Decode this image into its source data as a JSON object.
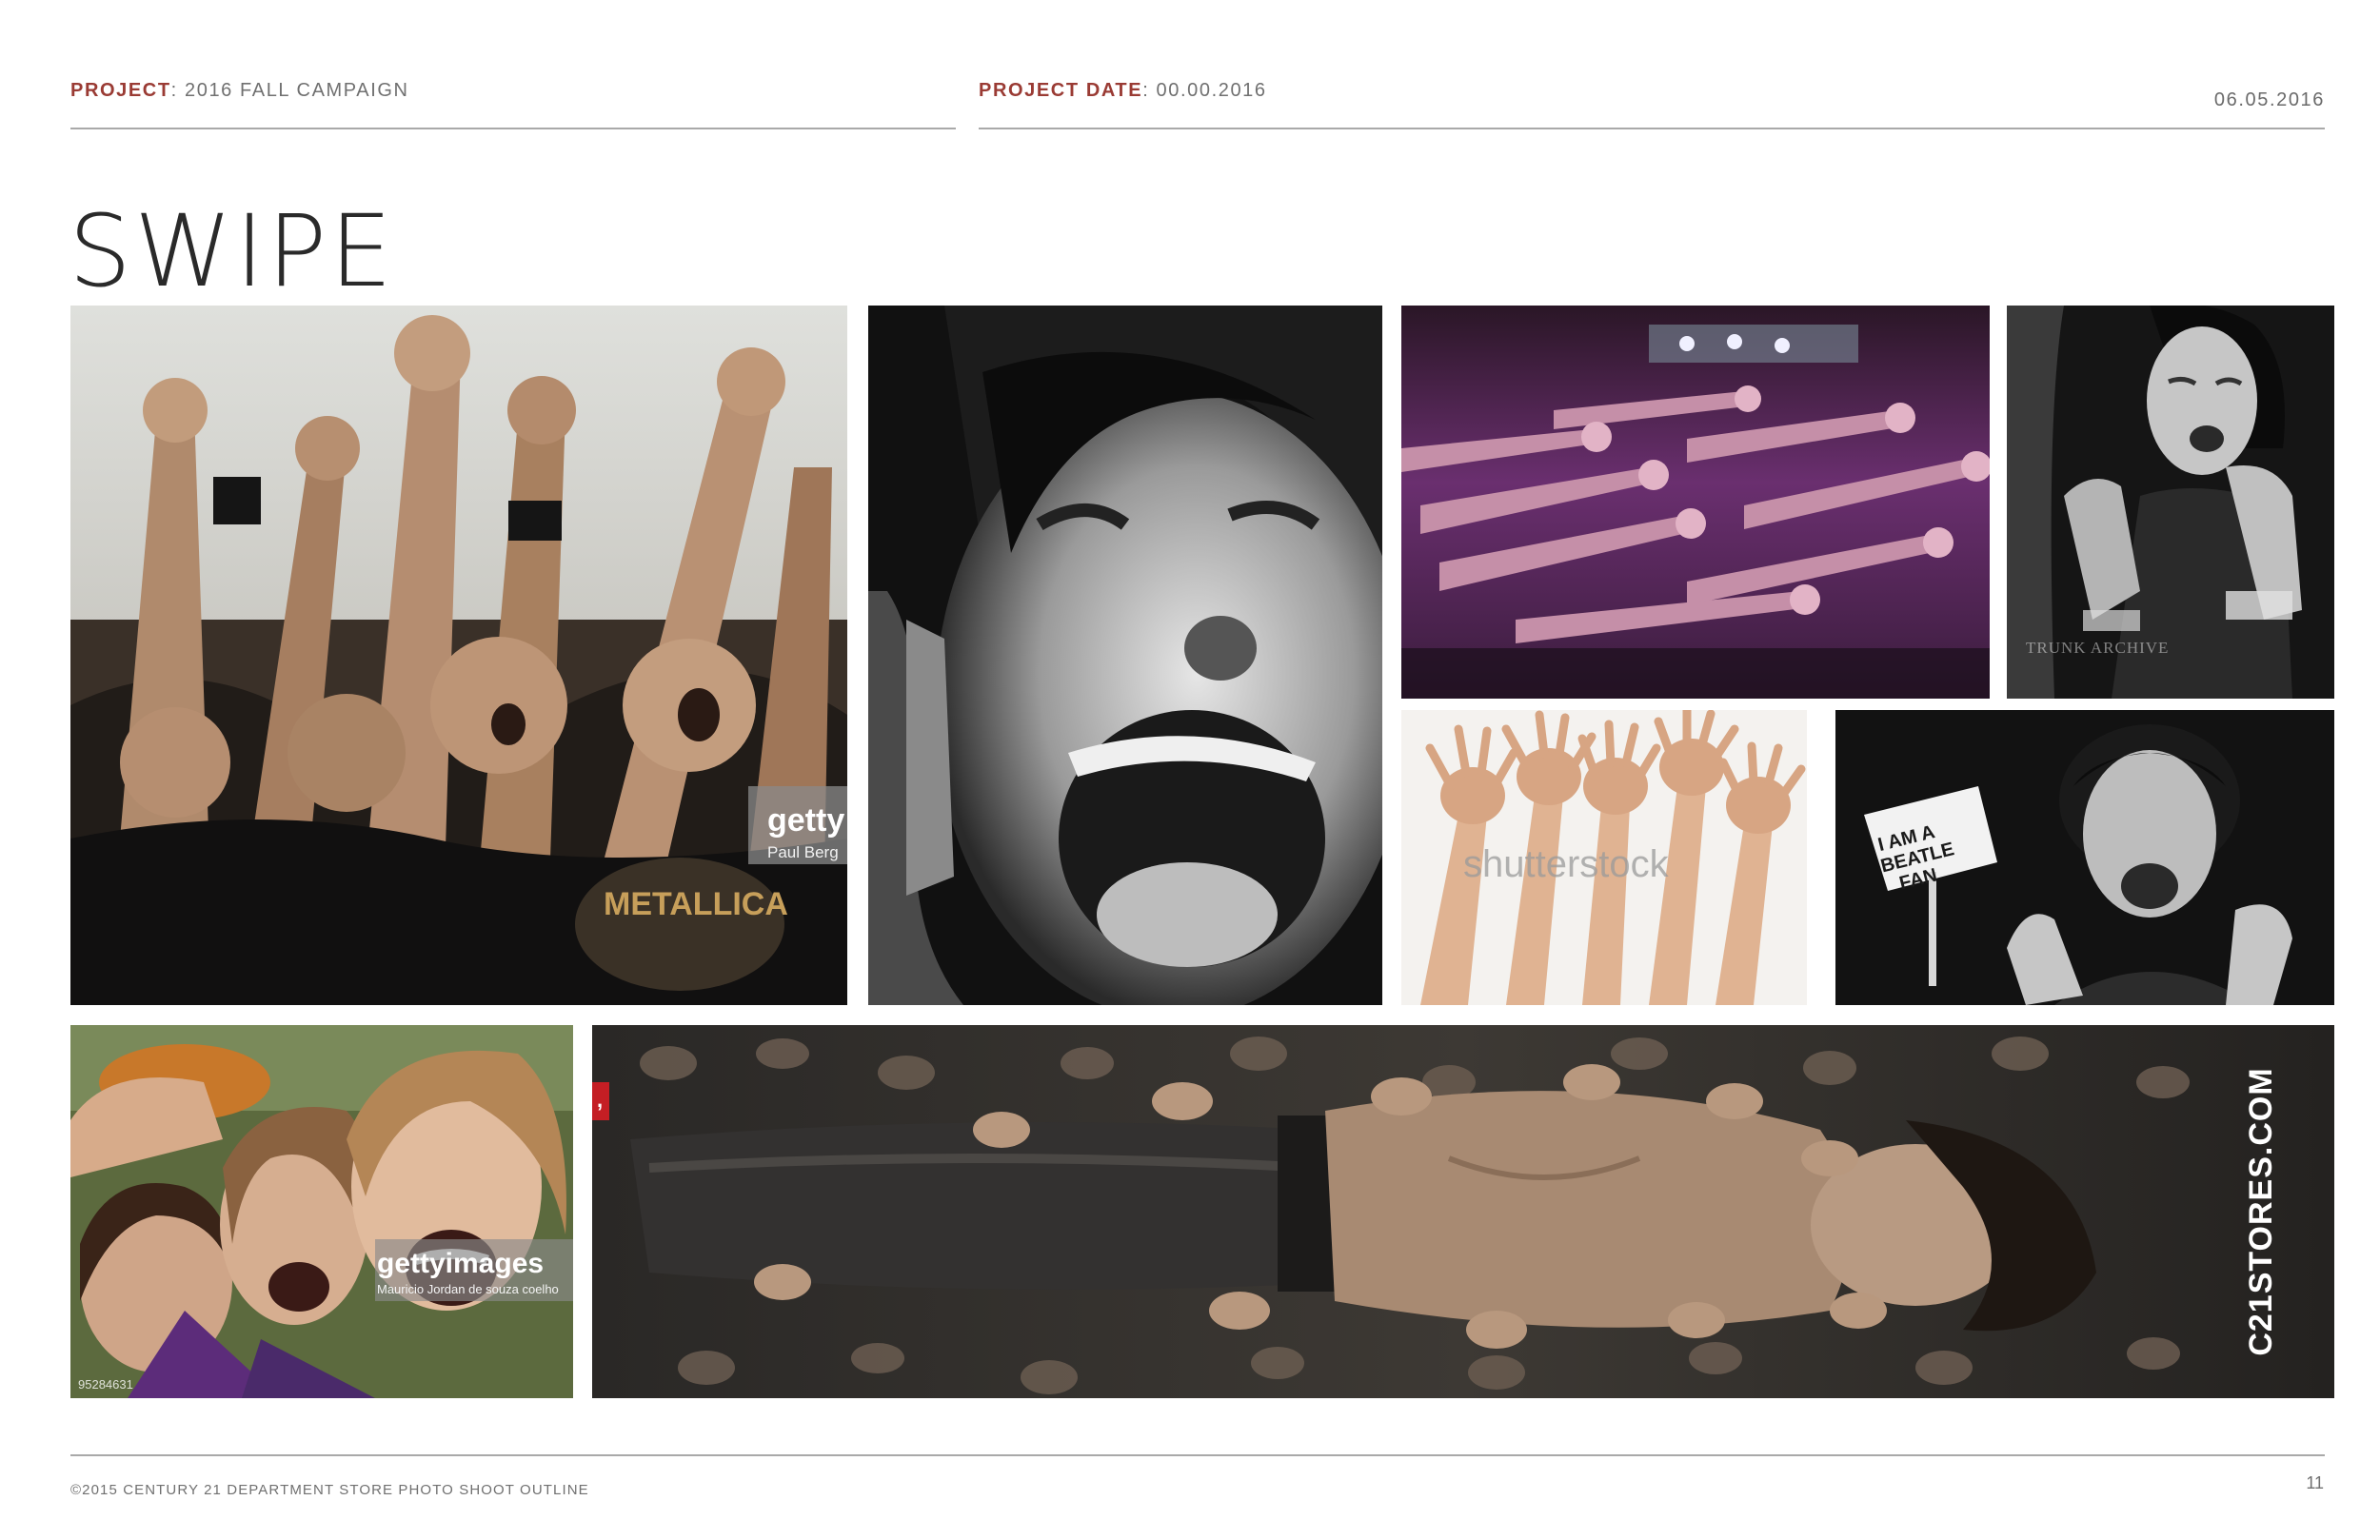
{
  "header": {
    "project_key": "PROJECT",
    "project_value": "2016 FALL CAMPAIGN",
    "project_date_key": "PROJECT DATE",
    "project_date_value": "00.00.2016",
    "date": "06.05.2016"
  },
  "title": "SWIPE",
  "photos": [
    {
      "id": "metal-crowd",
      "watermark": "getty",
      "credit": "Paul Berg",
      "shirt_text": "METALLICA"
    },
    {
      "id": "screaming-woman-bw"
    },
    {
      "id": "concert-hands-purple"
    },
    {
      "id": "woman-eyes-closed-bw",
      "watermark": "TRUNK ARCHIVE"
    },
    {
      "id": "hands-raised",
      "watermark": "shutterstock"
    },
    {
      "id": "beatle-fan-bw",
      "sign_lines": [
        "I AM A",
        "BEATLE",
        "FAN"
      ]
    },
    {
      "id": "girls-screaming",
      "watermark": "gettyimages",
      "credit": "Mauricio Jordan de souza coelho",
      "image_id": "95284631"
    },
    {
      "id": "crowd-surfer",
      "side_text": "C21STORES.COM"
    }
  ],
  "footer": {
    "copyright": "©2015 CENTURY 21 DEPARTMENT STORE PHOTO SHOOT OUTLINE",
    "page_number": "11"
  }
}
